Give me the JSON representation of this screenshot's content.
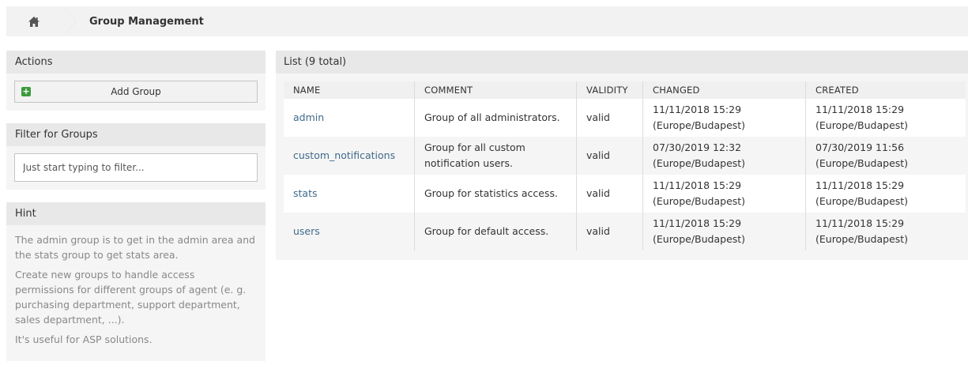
{
  "breadcrumb": {
    "home_icon": "home-icon",
    "current": "Group Management"
  },
  "sidebar": {
    "actions": {
      "title": "Actions",
      "add_button": "Add Group",
      "add_icon": "plus-square-icon",
      "add_icon_color": "#3c9b3c"
    },
    "filter": {
      "title": "Filter for Groups",
      "placeholder": "Just start typing to filter..."
    },
    "hint": {
      "title": "Hint",
      "paragraphs": [
        "The admin group is to get in the admin area and the stats group to get stats area.",
        "Create new groups to handle access permissions for different groups of agent (e. g. purchasing department, support department, sales department, ...).",
        "It's useful for ASP solutions."
      ]
    }
  },
  "main": {
    "title": "List (9 total)",
    "columns": [
      "NAME",
      "COMMENT",
      "VALIDITY",
      "CHANGED",
      "CREATED"
    ],
    "rows": [
      {
        "name": "admin",
        "comment": "Group of all administrators.",
        "validity": "valid",
        "changed": "11/11/2018 15:29 (Europe/Budapest)",
        "created": "11/11/2018 15:29 (Europe/Budapest)"
      },
      {
        "name": "custom_notifications",
        "comment": "Group for all custom notification users.",
        "validity": "valid",
        "changed": "07/30/2019 12:32 (Europe/Budapest)",
        "created": "07/30/2019 11:56 (Europe/Budapest)"
      },
      {
        "name": "stats",
        "comment": "Group for statistics access.",
        "validity": "valid",
        "changed": "11/11/2018 15:29 (Europe/Budapest)",
        "created": "11/11/2018 15:29 (Europe/Budapest)"
      },
      {
        "name": "users",
        "comment": "Group for default access.",
        "validity": "valid",
        "changed": "11/11/2018 15:29 (Europe/Budapest)",
        "created": "11/11/2018 15:29 (Europe/Budapest)"
      }
    ],
    "link_color": "#3f6a8a"
  }
}
